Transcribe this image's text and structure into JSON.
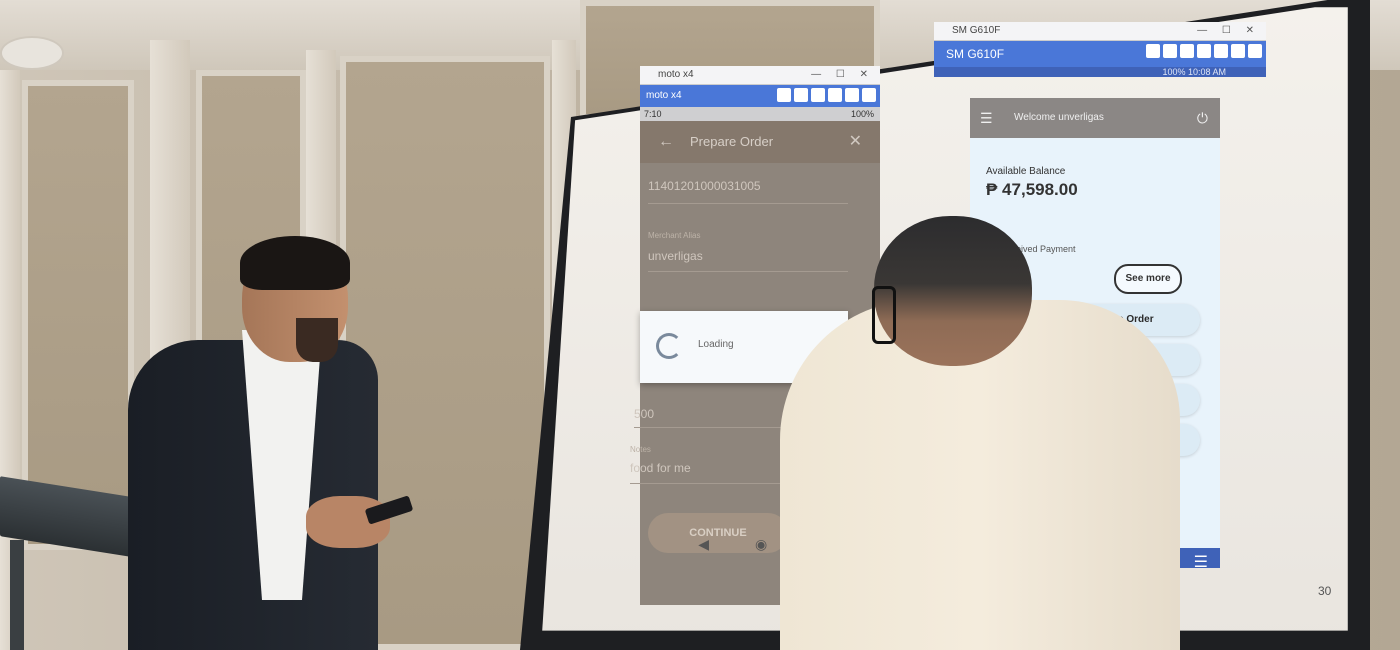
{
  "left_device": {
    "window_title": "moto x4",
    "toolbar_title": "moto x4",
    "status_time": "7:10",
    "status_right": "100%",
    "app": {
      "title": "Prepare Order",
      "account_number": "11401201000031005",
      "merchant_label": "Merchant Alias",
      "merchant_value": "unverligas",
      "loading_text": "Loading",
      "amount_value": "500",
      "notes_label": "Notes",
      "notes_value": "food for me",
      "continue_label": "CONTINUE"
    }
  },
  "right_device": {
    "window_title": "SM G610F",
    "toolbar_title": "SM G610F",
    "status_right": "100% 10:08 AM",
    "app": {
      "welcome": "Welcome unverligas",
      "balance_label": "Available Balance",
      "balance_value": "₱ 47,598.00",
      "received_label": "Received Payment",
      "see_more_label": "See more",
      "menu_items": [
        "Prepare Order",
        "Cash In / Out",
        "",
        ""
      ]
    }
  },
  "slide_number": "30",
  "icons": {
    "back": "←",
    "close": "✕",
    "menu": "☰",
    "power": "⏻",
    "nav_back": "◀",
    "nav_home": "◉",
    "nav_recent": "■"
  }
}
